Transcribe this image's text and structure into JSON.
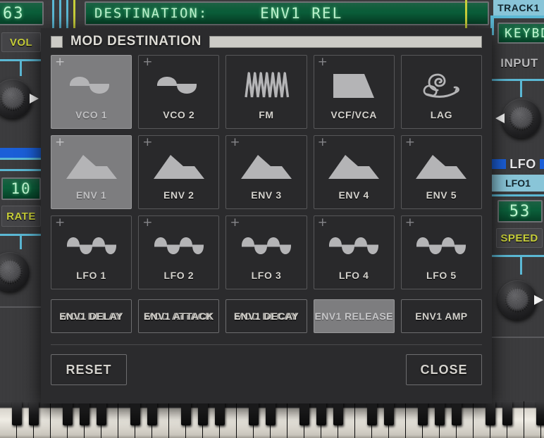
{
  "top_display": {
    "left_value": "63",
    "destination_label": "DESTINATION:",
    "destination_value": "ENV1 REL"
  },
  "left_rail": {
    "vol_label": "VOL",
    "rate_value": "10",
    "rate_label": "RATE"
  },
  "right_rail": {
    "track_tab": "TRACK1",
    "keyb_value": "KEYBD",
    "input_label": "INPUT",
    "lfo_label": "LFO",
    "lfo_select": "LFO1",
    "speed_value": "53",
    "speed_label": "SPEED"
  },
  "dialog": {
    "title": "MOD DESTINATION",
    "grid": [
      {
        "label": "VCO 1",
        "icon": "sine-wave-icon",
        "selected": true,
        "plus": true
      },
      {
        "label": "VCO 2",
        "icon": "sine-wave-icon",
        "selected": false,
        "plus": true
      },
      {
        "label": "FM",
        "icon": "fm-wave-icon",
        "selected": false,
        "plus": false
      },
      {
        "label": "VCF/VCA",
        "icon": "trapezoid-icon",
        "selected": false,
        "plus": true
      },
      {
        "label": "LAG",
        "icon": "snail-icon",
        "selected": false,
        "plus": false
      },
      {
        "label": "ENV 1",
        "icon": "envelope-icon",
        "selected": true,
        "plus": true
      },
      {
        "label": "ENV 2",
        "icon": "envelope-icon",
        "selected": false,
        "plus": true
      },
      {
        "label": "ENV 3",
        "icon": "envelope-icon",
        "selected": false,
        "plus": true
      },
      {
        "label": "ENV 4",
        "icon": "envelope-icon",
        "selected": false,
        "plus": true
      },
      {
        "label": "ENV 5",
        "icon": "envelope-icon",
        "selected": false,
        "plus": true
      },
      {
        "label": "LFO 1",
        "icon": "lfo-sine-icon",
        "selected": false,
        "plus": true
      },
      {
        "label": "LFO 2",
        "icon": "lfo-sine-icon",
        "selected": false,
        "plus": true
      },
      {
        "label": "LFO 3",
        "icon": "lfo-sine-icon",
        "selected": false,
        "plus": true
      },
      {
        "label": "LFO 4",
        "icon": "lfo-sine-icon",
        "selected": false,
        "plus": true
      },
      {
        "label": "LFO 5",
        "icon": "lfo-sine-icon",
        "selected": false,
        "plus": true
      }
    ],
    "param_buttons": [
      {
        "label": "ENV1 DELAY",
        "ghost_label": "MOD DELAY",
        "selected": false
      },
      {
        "label": "ENV1 ATTACK",
        "ghost_label": "MOD ATTACK",
        "selected": false
      },
      {
        "label": "ENV1 DECAY",
        "ghost_label": "MOD DECAY",
        "selected": false
      },
      {
        "label": "ENV1 RELEASE",
        "ghost_label": "",
        "selected": true
      },
      {
        "label": "ENV1 AMP",
        "ghost_label": "",
        "selected": false
      }
    ],
    "reset_label": "RESET",
    "close_label": "CLOSE"
  },
  "colors": {
    "lcd_green": "#0b5f3a",
    "lcd_text": "#bdf5cf",
    "accent_yellow": "#c8cf3a",
    "accent_cyan": "#89c5d8",
    "accent_blue": "#1b5fd8",
    "selected_cell": "#7d7d7f",
    "panel": "#2b2b2d"
  }
}
